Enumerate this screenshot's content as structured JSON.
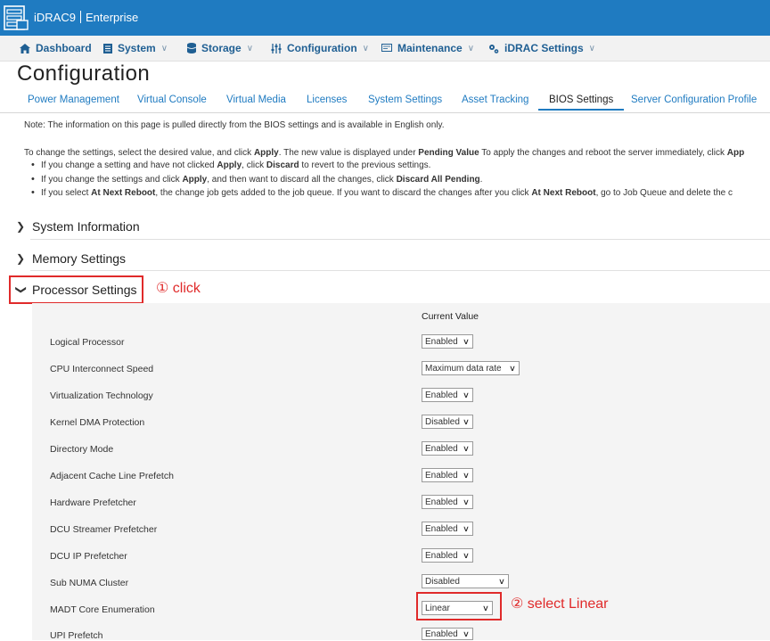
{
  "app": {
    "brand_name": "iDRAC9",
    "brand_edition": "Enterprise"
  },
  "nav": {
    "items": [
      {
        "label": "Dashboard",
        "icon": "home-icon",
        "has_menu": false
      },
      {
        "label": "System",
        "icon": "server-icon",
        "has_menu": true
      },
      {
        "label": "Storage",
        "icon": "database-icon",
        "has_menu": true
      },
      {
        "label": "Configuration",
        "icon": "sliders-icon",
        "has_menu": true
      },
      {
        "label": "Maintenance",
        "icon": "monitor-icon",
        "has_menu": true
      },
      {
        "label": "iDRAC Settings",
        "icon": "gears-icon",
        "has_menu": true
      }
    ]
  },
  "page": {
    "title": "Configuration"
  },
  "tabs": [
    {
      "label": "Power Management"
    },
    {
      "label": "Virtual Console"
    },
    {
      "label": "Virtual Media"
    },
    {
      "label": "Licenses"
    },
    {
      "label": "System Settings"
    },
    {
      "label": "Asset Tracking"
    },
    {
      "label": "BIOS Settings",
      "active": true
    },
    {
      "label": "Server Configuration Profile"
    }
  ],
  "notes": {
    "note": "Note: The information on this page is pulled directly from the BIOS settings and is available in English only.",
    "instruction_1": "To change the settings, select the desired value, and click ",
    "instruction_apply": "Apply",
    "instruction_2": ". The new value is displayed under ",
    "instruction_pending": "Pending Value",
    "instruction_3": " To apply the changes and reboot the server immediately, click ",
    "instruction_app": "App",
    "bullet1_a": "If you change a setting and have not clicked ",
    "bullet1_apply": "Apply",
    "bullet1_b": ", click ",
    "bullet1_discard": "Discard",
    "bullet1_c": " to revert to the previous settings.",
    "bullet2_a": "If you change the settings and click ",
    "bullet2_apply": "Apply",
    "bullet2_b": ", and then want to discard all the changes, click ",
    "bullet2_discard": "Discard All Pending",
    "bullet2_c": ".",
    "bullet3_a": "If you select ",
    "bullet3_reboot": "At Next Reboot",
    "bullet3_b": ", the change job gets added to the job queue. If you want to discard the changes after you click ",
    "bullet3_reboot2": "At Next Reboot",
    "bullet3_c": ", go to Job Queue and delete the c"
  },
  "sections": {
    "system_information": "System Information",
    "memory_settings": "Memory Settings",
    "processor_settings": "Processor Settings"
  },
  "annotations": {
    "step1": "① click",
    "step2": "② select Linear"
  },
  "processor": {
    "column_header": "Current Value",
    "settings": [
      {
        "label": "Logical Processor",
        "value": "Enabled"
      },
      {
        "label": "CPU Interconnect Speed",
        "value": "Maximum data rate"
      },
      {
        "label": "Virtualization Technology",
        "value": "Enabled"
      },
      {
        "label": "Kernel DMA Protection",
        "value": "Disabled"
      },
      {
        "label": "Directory Mode",
        "value": "Enabled"
      },
      {
        "label": "Adjacent Cache Line Prefetch",
        "value": "Enabled"
      },
      {
        "label": "Hardware Prefetcher",
        "value": "Enabled"
      },
      {
        "label": "DCU Streamer Prefetcher",
        "value": "Enabled"
      },
      {
        "label": "DCU IP Prefetcher",
        "value": "Enabled"
      },
      {
        "label": "Sub NUMA Cluster",
        "value": "Disabled"
      },
      {
        "label": "MADT Core Enumeration",
        "value": "Linear"
      },
      {
        "label": "UPI Prefetch",
        "value": "Enabled"
      }
    ]
  },
  "colors": {
    "header_blue": "#1f7bc1",
    "nav_text": "#1f5f93",
    "annotation_red": "#e02a2a"
  }
}
